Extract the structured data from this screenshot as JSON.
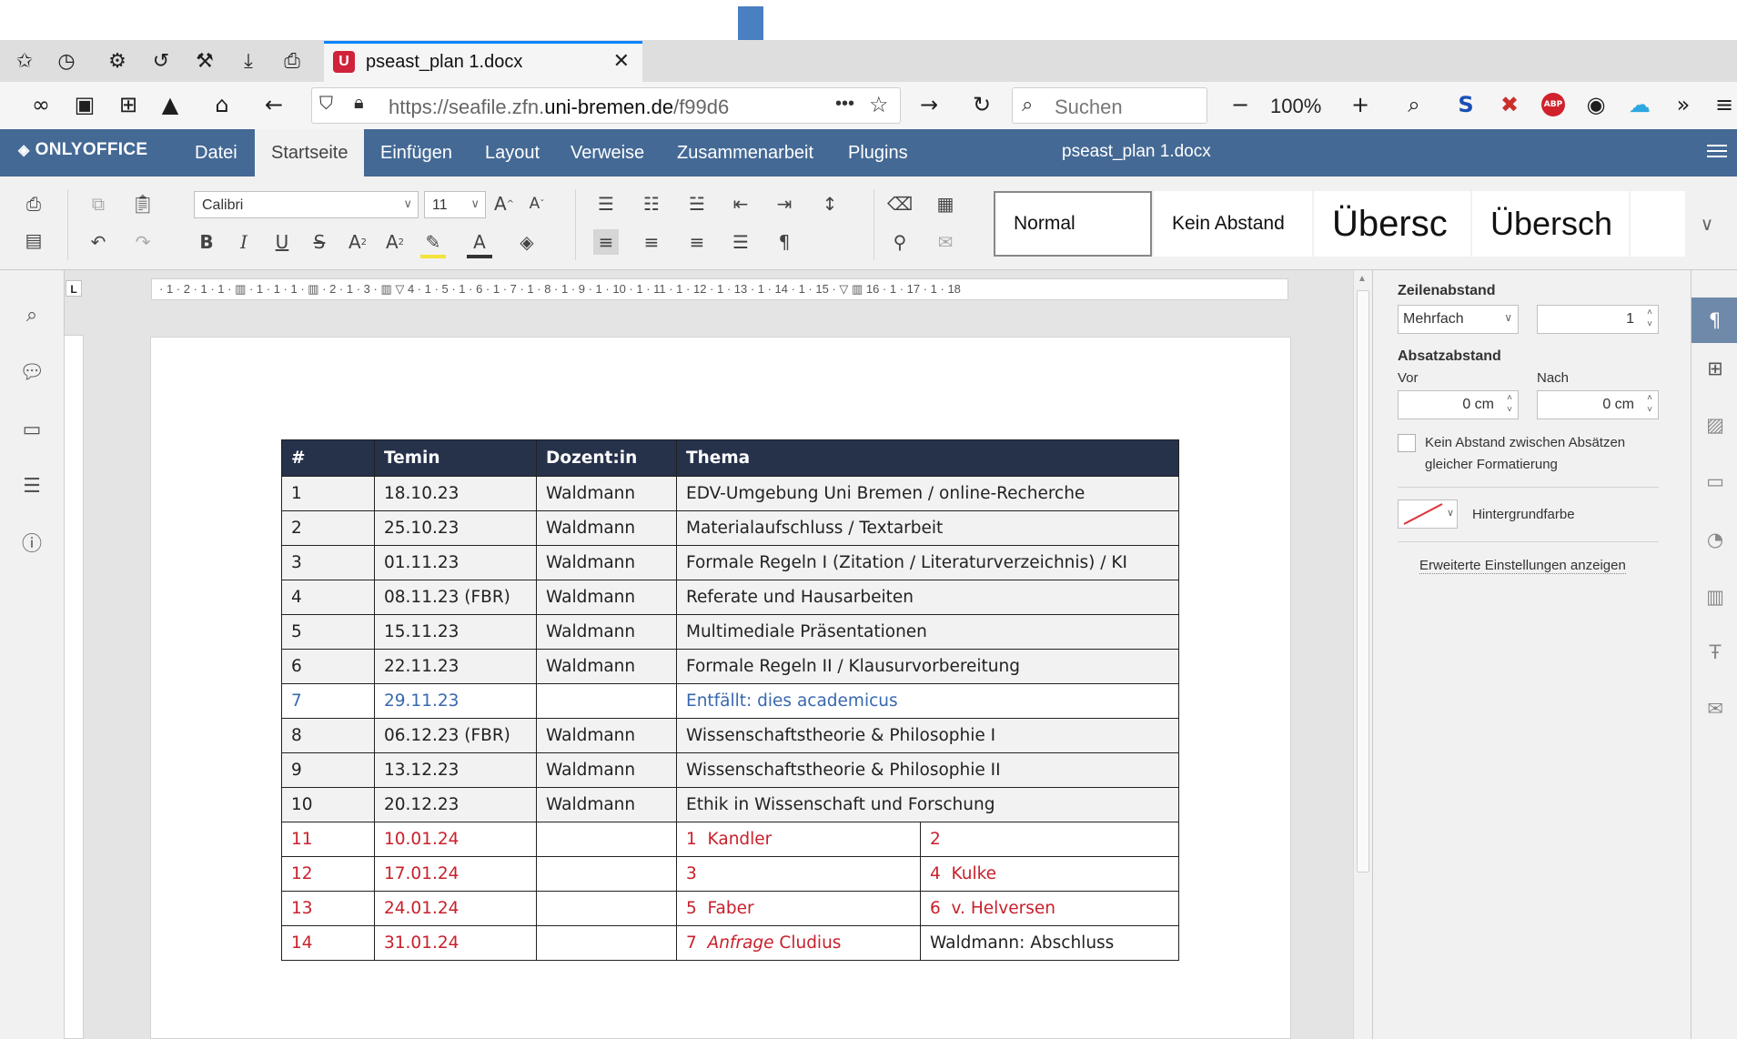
{
  "browser": {
    "tab_title": "pseast_plan 1.docx",
    "tab_close": "✕",
    "url_prefix": "https://seafile.zfn.",
    "url_domain": "uni-bremen.de",
    "url_suffix": "/f99d6",
    "url_more": "•••",
    "search_placeholder": "Suchen",
    "zoom": "100%",
    "zoom_minus": "−",
    "zoom_plus": "+"
  },
  "app": {
    "logo": "ONLYOFFICE",
    "doc_title": "pseast_plan 1.docx",
    "menu_tabs": [
      "Datei",
      "Startseite",
      "Einfügen",
      "Layout",
      "Verweise",
      "Zusammenarbeit",
      "Plugins"
    ],
    "active_tab": "Startseite"
  },
  "toolbar": {
    "font_name": "Calibri",
    "font_size": "11",
    "styles": [
      "Normal",
      "Kein Abstand",
      "Übersc",
      "Übersch"
    ]
  },
  "ruler": {
    "corner": "L",
    "labels": "· 1 · 2 · 1 · 1 ·  ▥ · 1 · 1 · 1 ·  ▥ · 2 · 1 · 3 · ▥ ▽ 4 · 1 · 5 · 1 · 6 · 1 · 7 · 1 · 8 · 1 · 9 · 1 · 10 · 1 · 11 · 1 · 12 · 1 · 13 · 1 · 14 · 1 · 15 · ▽ ▥ 16 · 1 · 17 · 1 · 18"
  },
  "table": {
    "headers": [
      "#",
      "Temin",
      "Dozent:in",
      "Thema"
    ],
    "rows": [
      {
        "num": "1",
        "date": "18.10.23",
        "lecturer": "Waldmann",
        "topic": "EDV-Umgebung Uni Bremen / online-Recherche"
      },
      {
        "num": "2",
        "date": "25.10.23",
        "lecturer": "Waldmann",
        "topic": "Materialaufschluss / Textarbeit"
      },
      {
        "num": "3",
        "date": "01.11.23",
        "lecturer": "Waldmann",
        "topic": "Formale Regeln I (Zitation / Literaturverzeichnis) / KI"
      },
      {
        "num": "4",
        "date": "08.11.23 (FBR)",
        "lecturer": "Waldmann",
        "topic": "Referate und Hausarbeiten"
      },
      {
        "num": "5",
        "date": "15.11.23",
        "lecturer": "Waldmann",
        "topic": "Multimediale Präsentationen"
      },
      {
        "num": "6",
        "date": "22.11.23",
        "lecturer": "Waldmann",
        "topic": "Formale Regeln II / Klausurvorbereitung"
      },
      {
        "num": "7",
        "date": "29.11.23",
        "lecturer": "",
        "topic": "Entfällt: dies academicus"
      },
      {
        "num": "8",
        "date": "06.12.23 (FBR)",
        "lecturer": "Waldmann",
        "topic": "Wissenschaftstheorie & Philosophie I"
      },
      {
        "num": "9",
        "date": "13.12.23",
        "lecturer": "Waldmann",
        "topic": "Wissenschaftstheorie & Philosophie II"
      },
      {
        "num": "10",
        "date": "20.12.23",
        "lecturer": "Waldmann",
        "topic": "Ethik in Wissenschaft und Forschung"
      }
    ],
    "split_rows": [
      {
        "num": "11",
        "date": "10.01.24",
        "a_num": "1",
        "a_name": "Kandler",
        "b_num": "2",
        "b_name": ""
      },
      {
        "num": "12",
        "date": "17.01.24",
        "a_num": "3",
        "a_name": "",
        "b_num": "4",
        "b_name": "Kulke"
      },
      {
        "num": "13",
        "date": "24.01.24",
        "a_num": "5",
        "a_name": "Faber",
        "b_num": "6",
        "b_name": "v. Helversen"
      },
      {
        "num": "14",
        "date": "31.01.24",
        "a_num": "7",
        "a_italic": "Anfrage",
        "a_name": "Cludius",
        "b_text": "Waldmann: Abschluss"
      }
    ]
  },
  "right_panel": {
    "line_spacing_label": "Zeilenabstand",
    "line_spacing_mode": "Mehrfach",
    "line_spacing_value": "1",
    "para_spacing_label": "Absatzabstand",
    "before_label": "Vor",
    "after_label": "Nach",
    "before_value": "0 cm",
    "after_value": "0 cm",
    "no_spacing_label": "Kein Abstand zwischen Absätzen gleicher Formatierung",
    "background_label": "Hintergrundfarbe",
    "advanced_link": "Erweiterte Einstellungen anzeigen"
  },
  "colors": {
    "header_bg": "#446995",
    "table_header_bg": "#26314a",
    "cancelled_blue": "#3868ae",
    "red_rows": "#c8202b",
    "arrow": "#4a7fc1"
  }
}
